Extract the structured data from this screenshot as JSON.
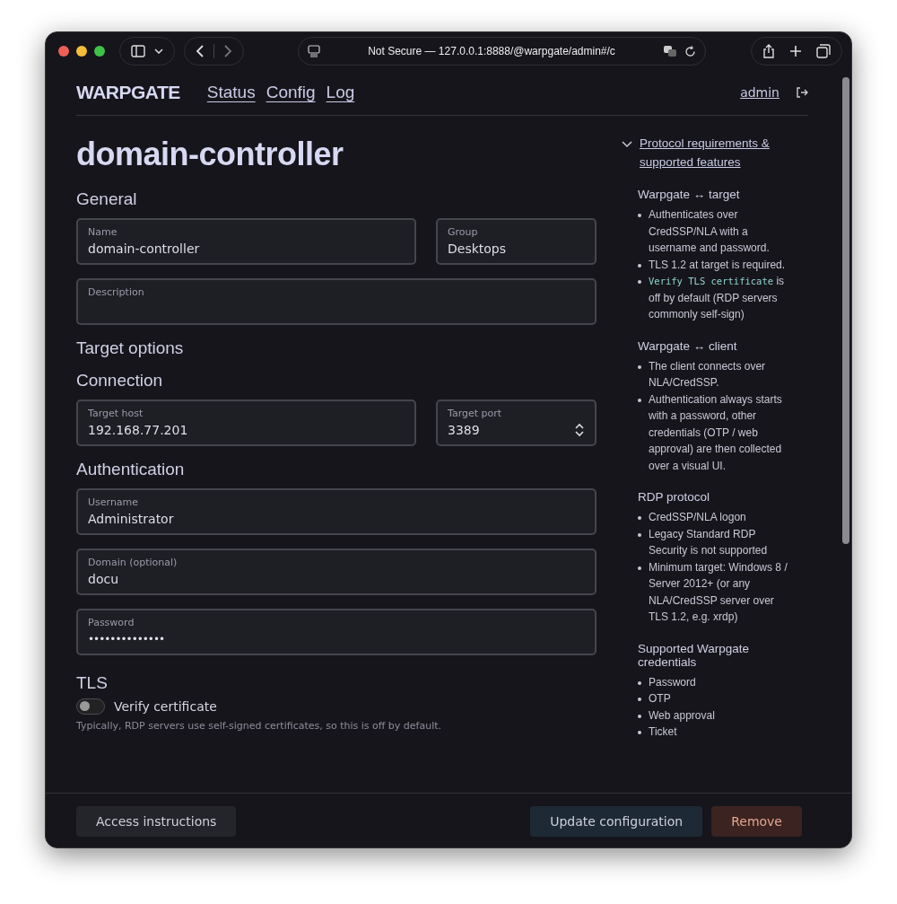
{
  "browser": {
    "address": "Not Secure — 127.0.0.1:8888/@warpgate/admin#/c"
  },
  "nav": {
    "logo": "WARPGATE",
    "links": [
      "Status",
      "Config",
      "Log"
    ],
    "user": "admin"
  },
  "title": "domain-controller",
  "sections": [
    {
      "heading": "General",
      "rows": [
        [
          {
            "label": "Name",
            "value": "domain-controller",
            "kind": "text"
          },
          {
            "label": "Group",
            "value": "Desktops",
            "kind": "text"
          }
        ],
        [
          {
            "label": "Description",
            "kind": "area"
          }
        ]
      ]
    },
    {
      "heading": "Target options"
    },
    {
      "heading": "Connection",
      "rows": [
        [
          {
            "label": "Target host",
            "value": "192.168.77.201",
            "kind": "text"
          },
          {
            "label": "Target port",
            "value": "3389",
            "kind": "number"
          }
        ]
      ]
    },
    {
      "heading": "Authentication",
      "rows": [
        [
          {
            "label": "Username",
            "value": "Administrator",
            "kind": "text"
          }
        ],
        [
          {
            "label": "Domain (optional)",
            "value": "docu",
            "kind": "text"
          }
        ],
        [
          {
            "label": "Password",
            "value": "••••••••••••••",
            "kind": "password"
          }
        ]
      ]
    }
  ],
  "tls": {
    "heading": "TLS",
    "toggle": {
      "label": "Verify certificate",
      "checked": false
    },
    "hint": "Typically, RDP servers use self-signed certificates, so this is off by default."
  },
  "sidebar": {
    "toggle": {
      "label": "Protocol requirements & supported features",
      "expanded": true
    },
    "groups": [
      {
        "heading": "Warpgate ↔ target",
        "items": [
          {
            "text": "Authenticates over CredSSP/NLA with a username and password."
          },
          {
            "text": "TLS 1.2 at target is required."
          },
          {
            "code": "Verify TLS certificate",
            "text": " is off by default (RDP servers commonly self-sign)"
          }
        ]
      },
      {
        "heading": "Warpgate ↔ client",
        "items": [
          {
            "text": "The client connects over NLA/CredSSP."
          },
          {
            "text": "Authentication always starts with a password, other credentials (OTP / web approval) are then collected over a visual UI."
          }
        ]
      },
      {
        "heading": "RDP protocol",
        "items": [
          {
            "text": "CredSSP/NLA logon"
          },
          {
            "text": "Legacy Standard RDP Security is not supported"
          },
          {
            "text": "Minimum target: Windows 8 / Server 2012+ (or any NLA/CredSSP server over TLS 1.2, e.g. xrdp)"
          }
        ]
      },
      {
        "heading": "Supported Warpgate credentials",
        "items": [
          {
            "text": "Password"
          },
          {
            "text": "OTP"
          },
          {
            "text": "Web approval"
          },
          {
            "text": "Ticket"
          }
        ]
      }
    ]
  },
  "footer": {
    "buttons": [
      {
        "label": "Access instructions",
        "kind": "secondary"
      },
      {
        "label": "Update configuration",
        "kind": "primary"
      },
      {
        "label": "Remove",
        "kind": "danger"
      }
    ]
  }
}
